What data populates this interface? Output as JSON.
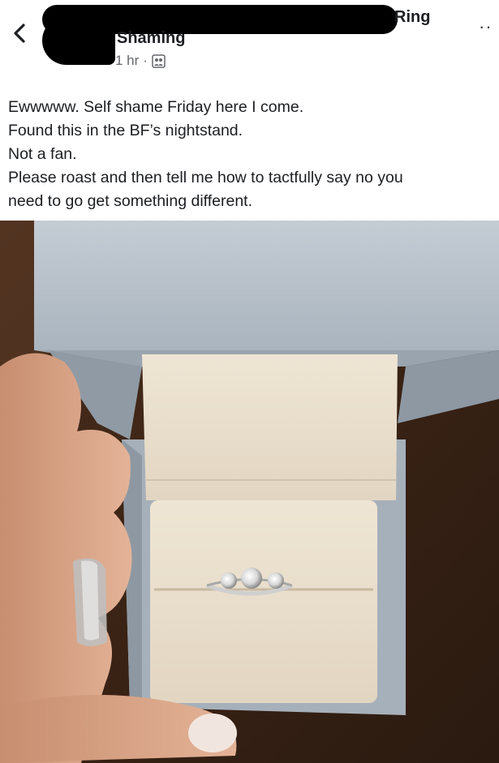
{
  "header": {
    "back_icon": "chevron-left-icon",
    "group_name_part1": "Ring",
    "group_name_part2": "Shaming",
    "timestamp": "1 hr",
    "separator": "·",
    "privacy_icon": "group-privacy-icon",
    "more_icon": "more-options-icon"
  },
  "post": {
    "lines": [
      "Ewwwww. Self shame Friday here I come.",
      "Found this in the BF’s nightstand.",
      "Not a fan.",
      "Please roast and then tell me how to tactfully say no you",
      "need to go get something different."
    ]
  },
  "photo": {
    "icon": "ring-box-photo",
    "colors": {
      "box": "#b8c2cc",
      "cushion": "#ece3d4",
      "wood": "#3a2416",
      "skin": "#d9a888"
    }
  }
}
